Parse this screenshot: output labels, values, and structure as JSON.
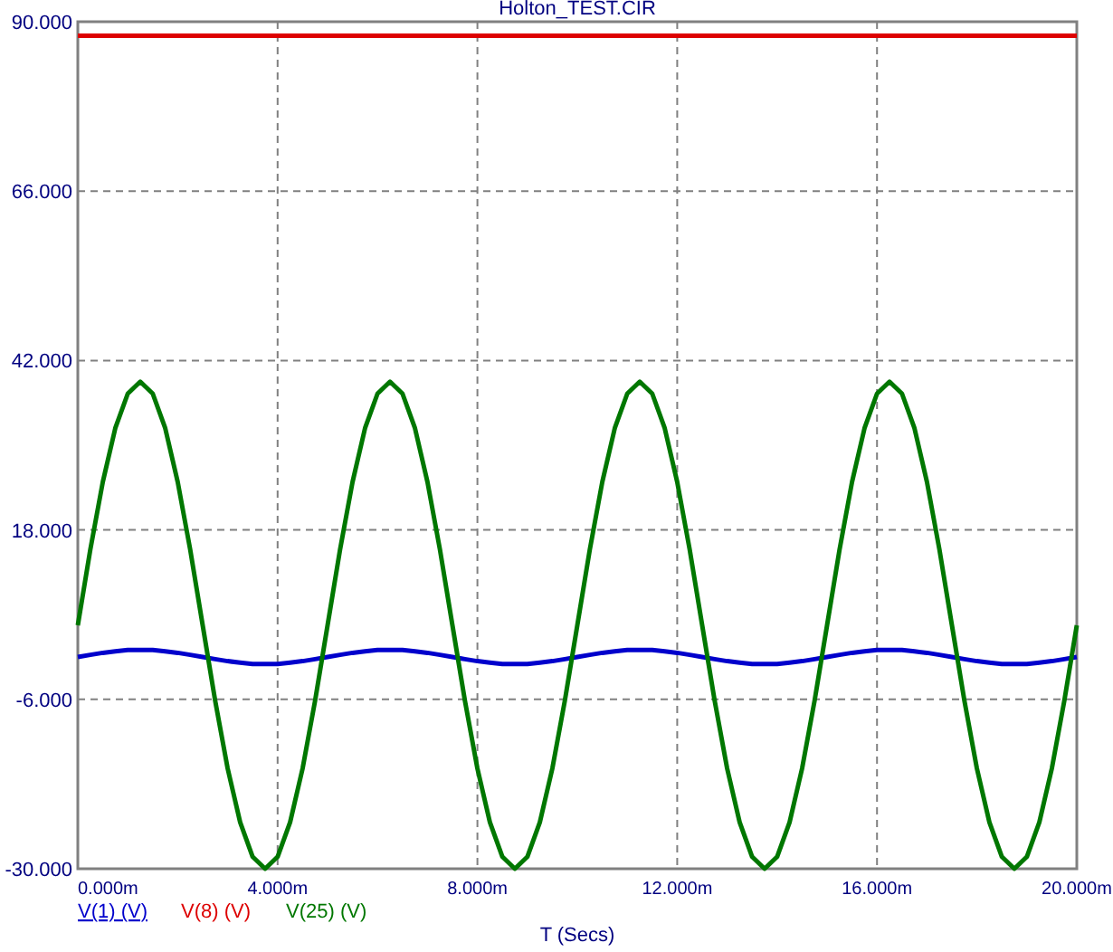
{
  "chart_data": {
    "type": "line",
    "title": "Holton_TEST.CIR",
    "xlabel": "T (Secs)",
    "x": [
      0,
      0.25,
      0.5,
      0.75,
      1,
      1.25,
      1.5,
      1.75,
      2,
      2.25,
      2.5,
      2.75,
      3,
      3.25,
      3.5,
      3.75,
      4,
      4.25,
      4.5,
      4.75,
      5,
      5.25,
      5.5,
      5.75,
      6,
      6.25,
      6.5,
      6.75,
      7,
      7.25,
      7.5,
      7.75,
      8,
      8.25,
      8.5,
      8.75,
      9,
      9.25,
      9.5,
      9.75,
      10,
      10.25,
      10.5,
      10.75,
      11,
      11.25,
      11.5,
      11.75,
      12,
      12.25,
      12.5,
      12.75,
      13,
      13.25,
      13.5,
      13.75,
      14,
      14.25,
      14.5,
      14.75,
      15,
      15.25,
      15.5,
      15.75,
      16,
      16.25,
      16.5,
      16.75,
      17,
      17.25,
      17.5,
      17.75,
      18,
      18.25,
      18.5,
      18.75,
      19,
      19.25,
      19.5,
      19.75,
      20
    ],
    "grid": true,
    "xlim": [
      0,
      20
    ],
    "ylim": [
      -30,
      90
    ],
    "xticks": [
      {
        "value": 0,
        "label": "0.000m"
      },
      {
        "value": 4,
        "label": "4.000m"
      },
      {
        "value": 8,
        "label": "8.000m"
      },
      {
        "value": 12,
        "label": "12.000m"
      },
      {
        "value": 16,
        "label": "16.000m"
      },
      {
        "value": 20,
        "label": "20.000m"
      }
    ],
    "yticks": [
      {
        "value": 90,
        "label": "90.000"
      },
      {
        "value": 66,
        "label": "66.000"
      },
      {
        "value": 42,
        "label": "42.000"
      },
      {
        "value": 18,
        "label": "18.000"
      },
      {
        "value": -6,
        "label": "-6.000"
      },
      {
        "value": -30,
        "label": "-30.000"
      }
    ],
    "series": [
      {
        "name": "V(1) (V)",
        "color": "#0000cc",
        "values": [
          0,
          0.3,
          0.6,
          0.8,
          1,
          1,
          1,
          0.8,
          0.6,
          0.3,
          0,
          -0.3,
          -0.6,
          -0.8,
          -1,
          -1,
          -1,
          -0.8,
          -0.6,
          -0.3,
          0,
          0.3,
          0.6,
          0.8,
          1,
          1,
          1,
          0.8,
          0.6,
          0.3,
          0,
          -0.3,
          -0.6,
          -0.8,
          -1,
          -1,
          -1,
          -0.8,
          -0.6,
          -0.3,
          0,
          0.3,
          0.6,
          0.8,
          1,
          1,
          1,
          0.8,
          0.6,
          0.3,
          0,
          -0.3,
          -0.6,
          -0.8,
          -1,
          -1,
          -1,
          -0.8,
          -0.6,
          -0.3,
          0,
          0.3,
          0.6,
          0.8,
          1,
          1,
          1,
          0.8,
          0.6,
          0.3,
          0,
          -0.3,
          -0.6,
          -0.8,
          -1,
          -1,
          -1,
          -0.8,
          -0.6,
          -0.3,
          0
        ]
      },
      {
        "name": "V(8) (V)",
        "color": "#dd0000",
        "values": [
          88,
          88,
          88,
          88,
          88,
          88,
          88,
          88,
          88,
          88,
          88,
          88,
          88,
          88,
          88,
          88,
          88,
          88,
          88,
          88,
          88,
          88,
          88,
          88,
          88,
          88,
          88,
          88,
          88,
          88,
          88,
          88,
          88,
          88,
          88,
          88,
          88,
          88,
          88,
          88,
          88,
          88,
          88,
          88,
          88,
          88,
          88,
          88,
          88,
          88,
          88,
          88,
          88,
          88,
          88,
          88,
          88,
          88,
          88,
          88,
          88,
          88,
          88,
          88,
          88,
          88,
          88,
          88,
          88,
          88,
          88,
          88,
          88,
          88,
          88,
          88,
          88,
          88,
          88,
          88,
          88
        ]
      },
      {
        "name": "V(25) (V)",
        "color": "#007700",
        "values": [
          4.5,
          15.2,
          24.8,
          32.4,
          37.3,
          39,
          37.3,
          32.4,
          24.8,
          15.2,
          4.5,
          -6.2,
          -15.8,
          -23.4,
          -28.3,
          -30,
          -28.3,
          -23.4,
          -15.8,
          -6.2,
          4.5,
          15.2,
          24.8,
          32.4,
          37.3,
          39,
          37.3,
          32.4,
          24.8,
          15.2,
          4.5,
          -6.2,
          -15.8,
          -23.4,
          -28.3,
          -30,
          -28.3,
          -23.4,
          -15.8,
          -6.2,
          4.5,
          15.2,
          24.8,
          32.4,
          37.3,
          39,
          37.3,
          32.4,
          24.8,
          15.2,
          4.5,
          -6.2,
          -15.8,
          -23.4,
          -28.3,
          -30,
          -28.3,
          -23.4,
          -15.8,
          -6.2,
          4.5,
          15.2,
          24.8,
          32.4,
          37.3,
          39,
          37.3,
          32.4,
          24.8,
          15.2,
          4.5,
          -6.2,
          -15.8,
          -23.4,
          -28.3,
          -30,
          -28.3,
          -23.4,
          -15.8,
          -6.2,
          4.5
        ]
      }
    ]
  },
  "legend": [
    {
      "selected": true
    },
    {
      "selected": false
    },
    {
      "selected": false
    }
  ]
}
